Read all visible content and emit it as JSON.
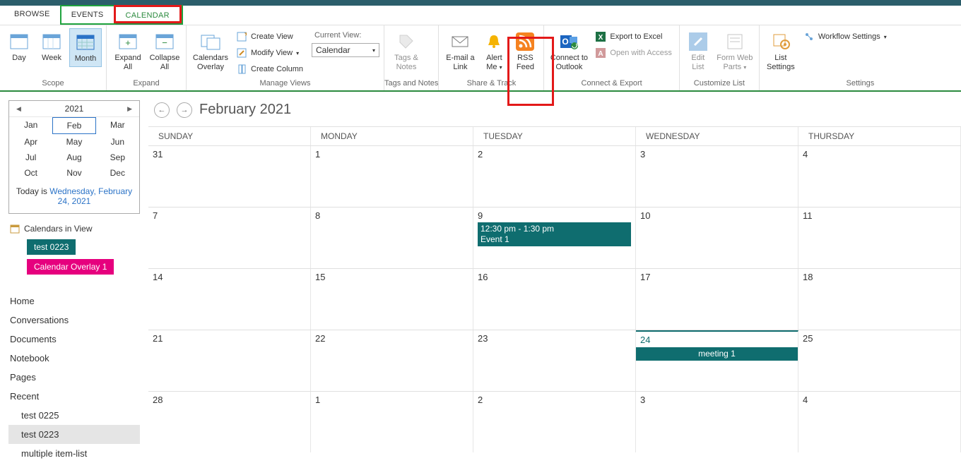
{
  "tabs": {
    "browse": "BROWSE",
    "events": "EVENTS",
    "calendar": "CALENDAR"
  },
  "ribbon": {
    "scope": {
      "day": "Day",
      "week": "Week",
      "month": "Month",
      "label": "Scope"
    },
    "expand": {
      "expand": "Expand All",
      "collapse": "Collapse All",
      "label": "Expand"
    },
    "manage": {
      "overlay": "Calendars Overlay",
      "create_view": "Create View",
      "modify_view": "Modify View",
      "create_column": "Create Column",
      "current_view_lbl": "Current View:",
      "current_view_value": "Calendar",
      "label": "Manage Views"
    },
    "tags": {
      "tags": "Tags & Notes",
      "label": "Tags and Notes"
    },
    "share": {
      "email": "E-mail a Link",
      "alert": "Alert Me",
      "rss": "RSS Feed",
      "label": "Share & Track"
    },
    "connect": {
      "outlook": "Connect to Outlook",
      "excel": "Export to Excel",
      "access": "Open with Access",
      "label": "Connect & Export"
    },
    "customize": {
      "edit": "Edit List",
      "form": "Form Web Parts",
      "label": "Customize List"
    },
    "settings": {
      "list": "List Settings",
      "workflow": "Workflow Settings",
      "label": "Settings"
    }
  },
  "sidebar": {
    "year": "2021",
    "months": [
      "Jan",
      "Feb",
      "Mar",
      "Apr",
      "May",
      "Jun",
      "Jul",
      "Aug",
      "Sep",
      "Oct",
      "Nov",
      "Dec"
    ],
    "current_month_index": 1,
    "today_prefix": "Today is ",
    "today_link": "Wednesday, February 24, 2021",
    "civ_title": "Calendars in View",
    "chip1": "test 0223",
    "chip2": "Calendar Overlay 1",
    "nav": [
      "Home",
      "Conversations",
      "Documents",
      "Notebook",
      "Pages",
      "Recent"
    ],
    "nav_sub": [
      "test 0225",
      "test 0223",
      "multiple item-list"
    ],
    "nav_selected_sub": 1
  },
  "calendar": {
    "title": "February 2021",
    "day_headers": [
      "SUNDAY",
      "MONDAY",
      "TUESDAY",
      "WEDNESDAY",
      "THURSDAY"
    ],
    "weeks": [
      [
        {
          "n": "31"
        },
        {
          "n": "1"
        },
        {
          "n": "2"
        },
        {
          "n": "3"
        },
        {
          "n": "4"
        }
      ],
      [
        {
          "n": "7"
        },
        {
          "n": "8"
        },
        {
          "n": "9",
          "evt_time": "12:30 pm - 1:30 pm",
          "evt_title": "Event 1"
        },
        {
          "n": "10"
        },
        {
          "n": "11"
        }
      ],
      [
        {
          "n": "14"
        },
        {
          "n": "15"
        },
        {
          "n": "16"
        },
        {
          "n": "17"
        },
        {
          "n": "18"
        }
      ],
      [
        {
          "n": "21"
        },
        {
          "n": "22"
        },
        {
          "n": "23"
        },
        {
          "n": "24",
          "today": true,
          "span_evt": "meeting 1"
        },
        {
          "n": "25"
        }
      ],
      [
        {
          "n": "28"
        },
        {
          "n": "1"
        },
        {
          "n": "2"
        },
        {
          "n": "3"
        },
        {
          "n": "4"
        }
      ]
    ]
  }
}
